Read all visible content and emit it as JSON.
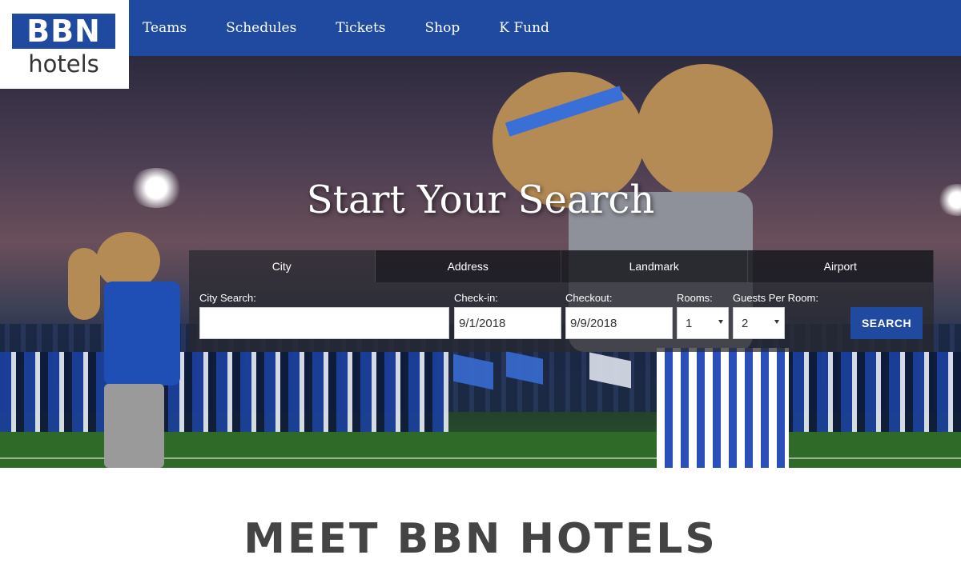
{
  "logo": {
    "top": "BBN",
    "bottom": "hotels"
  },
  "nav": {
    "items": [
      "Teams",
      "Schedules",
      "Tickets",
      "Shop",
      "K Fund"
    ]
  },
  "hero": {
    "title": "Start Your Search"
  },
  "search": {
    "tabs": [
      "City",
      "Address",
      "Landmark",
      "Airport"
    ],
    "active_tab": "City",
    "city_label": "City Search:",
    "city_value": "",
    "checkin_label": "Check-in:",
    "checkin_value": "9/1/2018",
    "checkout_label": "Checkout:",
    "checkout_value": "9/9/2018",
    "rooms_label": "Rooms:",
    "rooms_value": "1",
    "guests_label": "Guests Per Room:",
    "guests_value": "2",
    "button_label": "SEARCH"
  },
  "section": {
    "heading": "MEET BBN HOTELS"
  },
  "colors": {
    "brand_blue": "#1f4aa0",
    "white": "#ffffff"
  }
}
